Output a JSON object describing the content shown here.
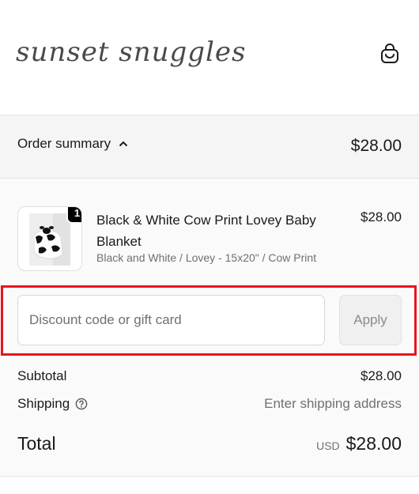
{
  "header": {
    "logo_text": "sunset snuggles",
    "cart_icon": "shopping-bag-icon"
  },
  "summary": {
    "label": "Order summary",
    "total": "$28.00",
    "toggle_icon": "chevron-up-icon"
  },
  "item": {
    "quantity": "1",
    "title": "Black & White Cow Print Lovey Baby Blanket",
    "variant": "Black and White / Lovey - 15x20\" / Cow Print",
    "price": "$28.00"
  },
  "discount": {
    "placeholder": "Discount code or gift card",
    "value": "",
    "apply_label": "Apply",
    "highlight_color": "#e8141b"
  },
  "totals": {
    "subtotal_label": "Subtotal",
    "subtotal_value": "$28.00",
    "shipping_label": "Shipping",
    "shipping_icon": "help-circle-icon",
    "shipping_value": "Enter shipping address",
    "total_label": "Total",
    "currency": "USD",
    "total_value": "$28.00"
  }
}
